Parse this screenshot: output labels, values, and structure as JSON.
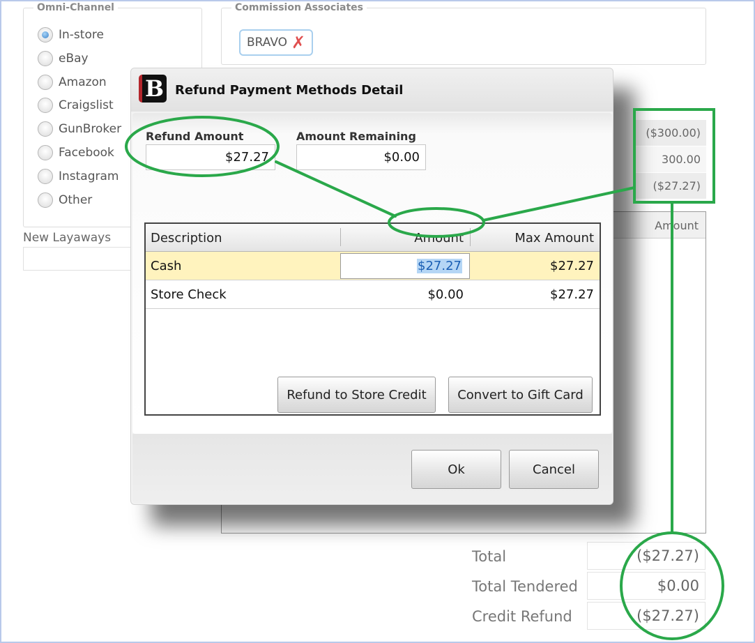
{
  "omni": {
    "title": "Omni-Channel",
    "options": [
      "In-store",
      "eBay",
      "Amazon",
      "Craigslist",
      "GunBroker",
      "Facebook",
      "Instagram",
      "Other"
    ],
    "selected": "In-store"
  },
  "layaways": {
    "label": "New Layaways"
  },
  "associates": {
    "title": "Commission Associates",
    "chip": "BRAVO"
  },
  "background_amounts": [
    "($300.00)",
    "300.00",
    "($27.27)"
  ],
  "background_table": {
    "amount_header": "Amount"
  },
  "totals": {
    "total_label": "Total",
    "total_value": "($27.27)",
    "tendered_label": "Total Tendered",
    "tendered_value": "$0.00",
    "credit_label": "Credit Refund",
    "credit_value": "($27.27)"
  },
  "dialog": {
    "logo_letter": "B",
    "title": "Refund Payment Methods Detail",
    "refund_amount_label": "Refund Amount",
    "refund_amount_value": "$27.27",
    "remaining_label": "Amount Remaining",
    "remaining_value": "$0.00",
    "table": {
      "headers": {
        "description": "Description",
        "amount": "Amount",
        "max_amount": "Max Amount"
      },
      "rows": [
        {
          "description": "Cash",
          "amount": "$27.27",
          "max_amount": "$27.27"
        },
        {
          "description": "Store Check",
          "amount": "$0.00",
          "max_amount": "$27.27"
        }
      ]
    },
    "buttons": {
      "store_credit": "Refund to Store Credit",
      "gift_card": "Convert to Gift Card",
      "ok": "Ok",
      "cancel": "Cancel"
    }
  },
  "annotation_color": "#2aa84a"
}
